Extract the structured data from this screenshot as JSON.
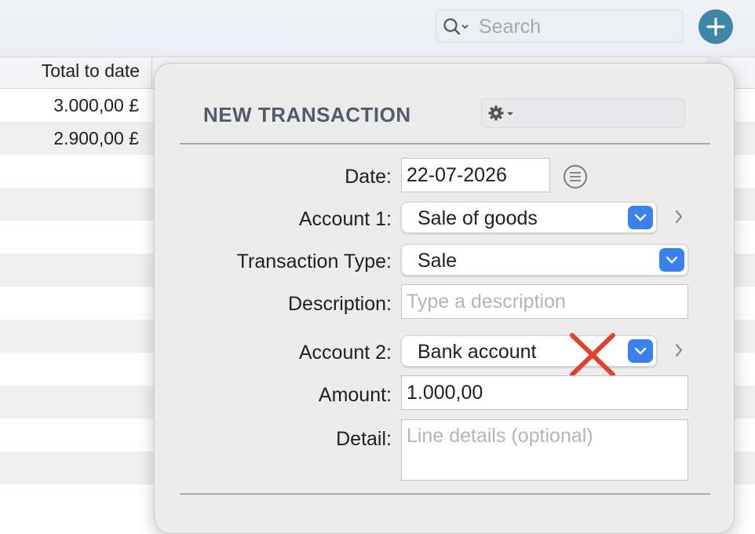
{
  "toolbar": {
    "search_placeholder": "Search",
    "search_icon": "magnifier-icon",
    "add_icon": "plus-icon",
    "accent_color": "#3d86a6"
  },
  "table": {
    "column_header": "Total to date",
    "rows": [
      "3.000,00 £",
      "2.900,00 £",
      "",
      "",
      "",
      "",
      "",
      "",
      "",
      "",
      "",
      "",
      ""
    ]
  },
  "popover": {
    "title": "NEW TRANSACTION",
    "gear_icon": "gear-icon",
    "fields": {
      "date": {
        "label": "Date:",
        "value": "22-07-2026"
      },
      "account1": {
        "label": "Account 1:",
        "value": "Sale of goods"
      },
      "transaction_type": {
        "label": "Transaction Type:",
        "value": "Sale"
      },
      "description": {
        "label": "Description:",
        "value": "",
        "placeholder": "Type a description"
      },
      "account2": {
        "label": "Account 2:",
        "value": "Bank account"
      },
      "amount": {
        "label": "Amount:",
        "value": "1.000,00"
      },
      "detail": {
        "label": "Detail:",
        "value": "",
        "placeholder": "Line details (optional)"
      }
    },
    "select_color": "#3a80f1",
    "annotation_color": "#e2412b"
  }
}
